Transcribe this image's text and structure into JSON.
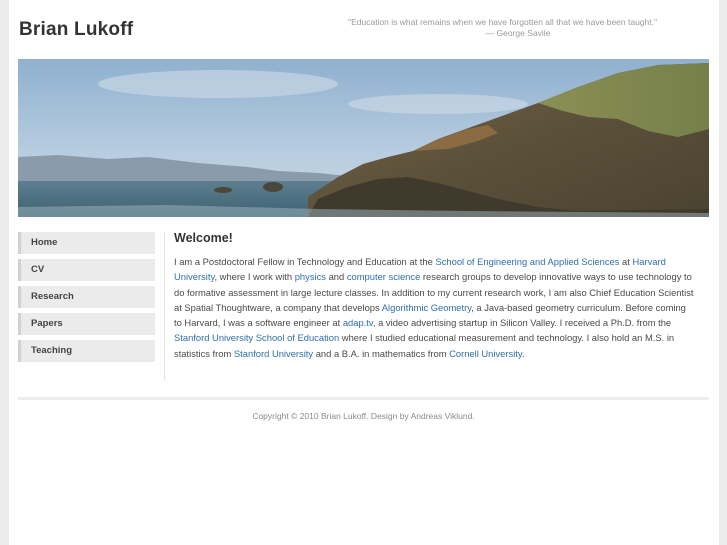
{
  "header": {
    "title": "Brian Lukoff",
    "quote": "\"Education is what remains when we have forgotten all that we have been taught.\"",
    "quote_author": "— George Savile"
  },
  "nav": {
    "items": [
      {
        "label": "Home"
      },
      {
        "label": "CV"
      },
      {
        "label": "Research"
      },
      {
        "label": "Papers"
      },
      {
        "label": "Teaching"
      }
    ]
  },
  "main": {
    "heading": "Welcome!",
    "p1": "I am a Postdoctoral Fellow in Technology and Education at the ",
    "link_seas": "School of Engineering and Applied Sciences",
    "p2": " at ",
    "link_harvard": "Harvard University",
    "p3": ", where I work with ",
    "link_physics": "physics",
    "p4": " and ",
    "link_cs": "computer science",
    "p5": " research groups to develop innovative ways to use technology to do formative assessment in large lecture classes. In addition to my current research work, I am also Chief Education Scientist at Spatial Thoughtware, a company that develops ",
    "link_ag": "Algorithmic Geometry",
    "p6": ", a Java-based geometry curriculum. Before coming to Harvard, I was a software engineer at ",
    "link_adap": "adap.tv",
    "p7": ", a video advertising startup in Silicon Valley. I received a Ph.D. from the ",
    "link_stanford_ed": "Stanford University School of Education",
    "p8": " where I studied educational measurement and technology. I also hold an M.S. in statistics from ",
    "link_stanford": "Stanford University",
    "p9": " and a B.A. in mathematics from ",
    "link_cornell": "Cornell University",
    "p10": "."
  },
  "footer": {
    "text": "Copyright © 2010 Brian Lukoff. Design by Andreas Viklund."
  },
  "colors": {
    "link": "#2f6fab",
    "nav_bg": "#ebebeb",
    "page_bg": "#ececec"
  }
}
